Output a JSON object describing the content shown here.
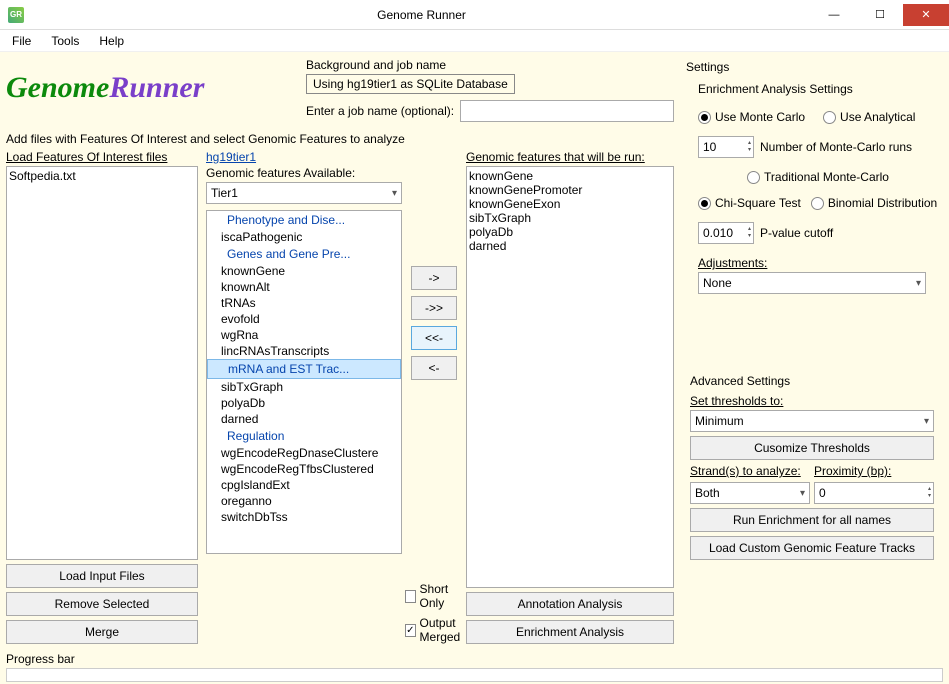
{
  "window": {
    "title": "Genome Runner",
    "icon_text": "GR"
  },
  "menu": [
    "File",
    "Tools",
    "Help"
  ],
  "logo": {
    "part1": "Genome",
    "part2": "Runner"
  },
  "bg_job": {
    "label": "Background and job name",
    "db_text": "Using hg19tier1 as SQLite Database",
    "job_label": "Enter a job name (optional):",
    "job_value": ""
  },
  "instruction": "Add files with Features Of Interest and select Genomic Features to analyze",
  "foi": {
    "label": "Load Features Of Interest files",
    "items": [
      "Softpedia.txt"
    ],
    "btn_load": "Load Input Files",
    "btn_remove": "Remove Selected",
    "btn_merge": "Merge"
  },
  "mid": {
    "link": "hg19tier1",
    "avail_label": "Genomic features Available:",
    "tier_value": "Tier1",
    "tree": [
      {
        "type": "group",
        "text": "Phenotype and Dise..."
      },
      {
        "type": "item",
        "text": "iscaPathogenic"
      },
      {
        "type": "group",
        "text": "Genes and Gene Pre..."
      },
      {
        "type": "item",
        "text": "knownGene"
      },
      {
        "type": "item",
        "text": "knownAlt"
      },
      {
        "type": "item",
        "text": "tRNAs"
      },
      {
        "type": "item",
        "text": "evofold"
      },
      {
        "type": "item",
        "text": "wgRna"
      },
      {
        "type": "item",
        "text": "lincRNAsTranscripts"
      },
      {
        "type": "group-sel",
        "text": "mRNA and EST Trac..."
      },
      {
        "type": "item",
        "text": "sibTxGraph"
      },
      {
        "type": "item",
        "text": "polyaDb"
      },
      {
        "type": "item",
        "text": "darned"
      },
      {
        "type": "group",
        "text": "Regulation"
      },
      {
        "type": "item",
        "text": "wgEncodeRegDnaseClustere"
      },
      {
        "type": "item",
        "text": "wgEncodeRegTfbsClustered"
      },
      {
        "type": "item",
        "text": "cpgIslandExt"
      },
      {
        "type": "item",
        "text": "oreganno"
      },
      {
        "type": "item",
        "text": "switchDbTss"
      }
    ]
  },
  "arrows": {
    "add": "->",
    "add_all": "->>",
    "remove_all": "<<-",
    "remove": "<-"
  },
  "run": {
    "label": "Genomic features that will be run:",
    "items": [
      "knownGene",
      "knownGenePromoter",
      "knownGeneExon",
      "sibTxGraph",
      "polyaDb",
      "darned"
    ],
    "short_only": "Short Only",
    "output_merged": "Output Merged",
    "btn_annotation": "Annotation Analysis",
    "btn_enrichment": "Enrichment Analysis"
  },
  "settings": {
    "title": "Settings",
    "sub": "Enrichment Analysis Settings",
    "monte": "Use Monte Carlo",
    "analytical": "Use Analytical",
    "num_runs": "10",
    "num_runs_label": "Number of Monte-Carlo runs",
    "trad": "Traditional Monte-Carlo",
    "chi": "Chi-Square Test",
    "binom": "Binomial Distribution",
    "pval": "0.010",
    "pval_label": "P-value cutoff",
    "adj_label": "Adjustments:",
    "adj_value": "None",
    "adv_title": "Advanced Settings",
    "thresh_label": "Set thresholds to:",
    "thresh_value": "Minimum",
    "btn_customize": "Cusomize Thresholds",
    "strand_label": "Strand(s) to analyze:",
    "strand_value": "Both",
    "prox_label": "Proximity (bp):",
    "prox_value": "0",
    "btn_run": "Run Enrichment for all names",
    "btn_load_tracks": "Load Custom Genomic Feature Tracks"
  },
  "progress": {
    "label": "Progress bar"
  }
}
